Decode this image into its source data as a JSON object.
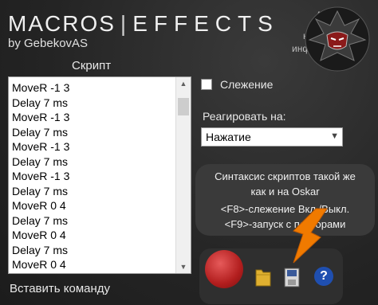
{
  "header": {
    "title_left": "MACROS",
    "title_sep": "|",
    "title_right": "EFFECTS",
    "author": "by GebekovAS"
  },
  "corner": {
    "line1": "Автор",
    "line2": "на",
    "line3": "инф"
  },
  "script_panel": {
    "label": "Скрипт",
    "lines": [
      "MoveR -1 3",
      "Delay 7 ms",
      "MoveR -1 3",
      "Delay 7 ms",
      "MoveR -1 3",
      "Delay 7 ms",
      "MoveR -1 3",
      "Delay 7 ms",
      "MoveR 0 4",
      "Delay 7 ms",
      "MoveR 0 4",
      "Delay 7 ms",
      "MoveR 0 4"
    ],
    "insert_command": "Вставить команду"
  },
  "options": {
    "tracking_label": "Слежение",
    "react_label": "Реагировать на:",
    "react_value": "Нажатие"
  },
  "info": {
    "line1": "Синтаксис скриптов такой же",
    "line2": "как и на Oskar",
    "line3": "<F8>-слежение Вкл./Выкл.",
    "line4": "<F9>-запуск с повторами"
  },
  "toolbar": {
    "help_glyph": "?"
  },
  "colors": {
    "record": "#c22a2a",
    "help": "#1f4fb0",
    "arrow": "#f07a00"
  }
}
